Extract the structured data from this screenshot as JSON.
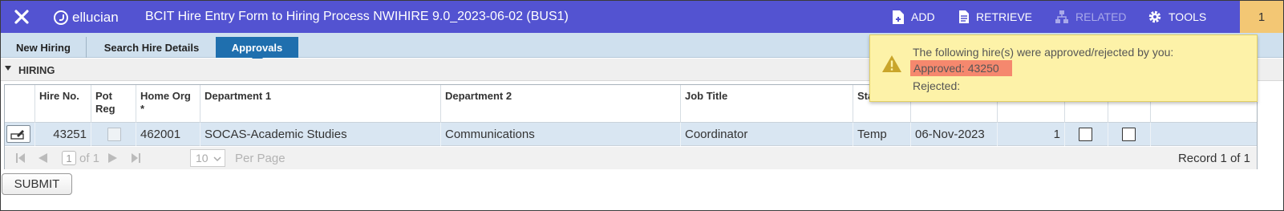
{
  "topbar": {
    "logo_text": "ellucian",
    "title": "BCIT Hire Entry Form to Hiring Process NWIHIRE 9.0_2023-06-02 (BUS1)",
    "actions": {
      "add": "ADD",
      "retrieve": "RETRIEVE",
      "related": "RELATED",
      "tools": "TOOLS"
    },
    "notification_count": "1"
  },
  "tabs": [
    {
      "label": "New Hiring"
    },
    {
      "label": "Search Hire Details"
    },
    {
      "label": "Approvals",
      "active": true
    }
  ],
  "section": {
    "label": "HIRING"
  },
  "table": {
    "headers": {
      "hire_no": "Hire No.",
      "pot_reg": "Pot Reg",
      "home_org": "Home Org *",
      "dept1": "Department 1",
      "dept2": "Department 2",
      "job_title": "Job Title",
      "status": "Sta"
    },
    "rows": [
      {
        "hire_no": "43251",
        "pot_reg": false,
        "home_org": "462001",
        "dept1": "SOCAS-Academic Studies",
        "dept2": "Communications",
        "job_title": "Coordinator",
        "status": "Temp",
        "date": "06-Nov-2023",
        "count": "1",
        "approve": false,
        "reject": false
      }
    ]
  },
  "pager": {
    "page": "1",
    "of": "of 1",
    "per_page_value": "10",
    "per_page_label": "Per Page",
    "record": "Record 1 of 1"
  },
  "submit_label": "SUBMIT",
  "notification": {
    "line1": "The following hire(s) were approved/rejected by you:",
    "approved": "Approved: 43250",
    "rejected": "Rejected:"
  },
  "colors": {
    "topbar": "#5353d1",
    "tab_active": "#1f6fae",
    "tabstrip": "#cfe0ee",
    "row_selected": "#d9e6f2",
    "notification_bg": "#fdf2a8",
    "approved_highlight": "#f5886e",
    "count_badge": "#f3c774"
  }
}
